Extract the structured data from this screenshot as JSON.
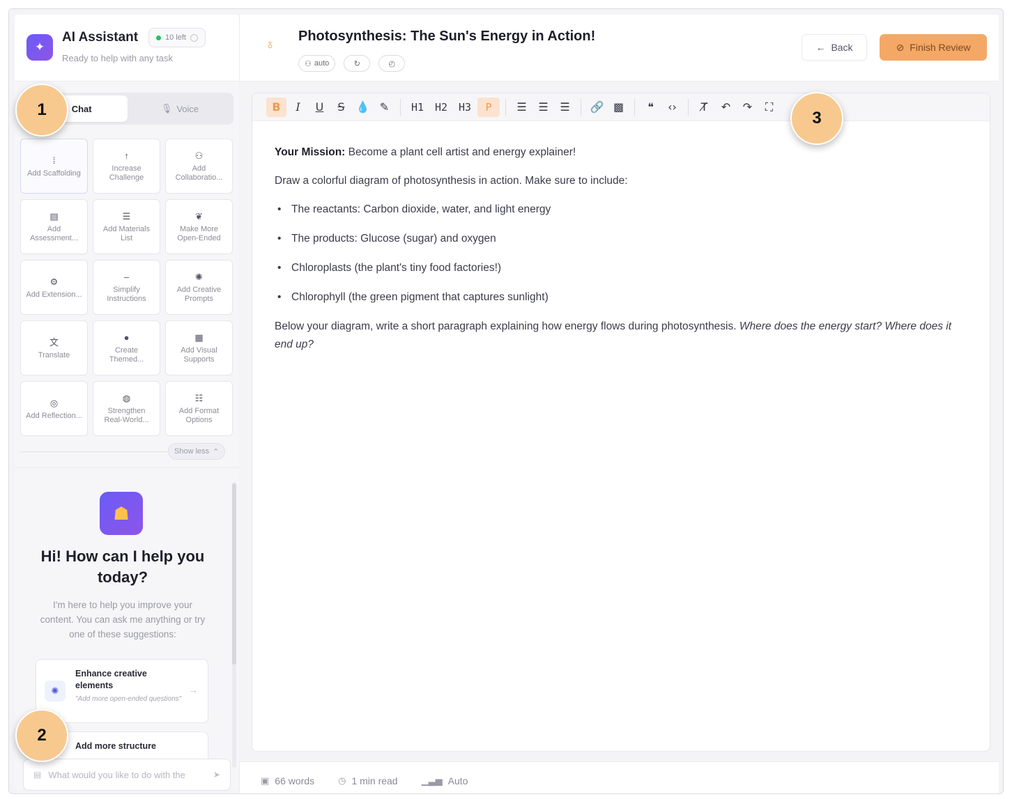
{
  "sidebar": {
    "title": "AI Assistant",
    "subtitle": "Ready to help with any task",
    "quota": "10 left",
    "tabs": [
      {
        "label": "Chat"
      },
      {
        "label": "Voice"
      }
    ],
    "quick_actions": [
      {
        "label": "Add Scaffolding",
        "icon": "ladder-icon"
      },
      {
        "label": "Increase Challenge",
        "icon": "arrow-up-icon"
      },
      {
        "label": "Add Collaboratio...",
        "icon": "group-icon"
      },
      {
        "label": "Add Assessment...",
        "icon": "clipboard-icon"
      },
      {
        "label": "Add Materials List",
        "icon": "list-icon"
      },
      {
        "label": "Make More Open-Ended",
        "icon": "brain-icon"
      },
      {
        "label": "Add Extension...",
        "icon": "extension-icon"
      },
      {
        "label": "Simplify Instructions",
        "icon": "minus-icon"
      },
      {
        "label": "Add Creative Prompts",
        "icon": "lightbulb-icon"
      },
      {
        "label": "Translate",
        "icon": "translate-icon"
      },
      {
        "label": "Create Themed...",
        "icon": "palette-icon"
      },
      {
        "label": "Add Visual Supports",
        "icon": "image-stack-icon"
      },
      {
        "label": "Add Reflection...",
        "icon": "reflection-icon"
      },
      {
        "label": "Strengthen Real-World...",
        "icon": "globe-icon"
      },
      {
        "label": "Add Format Options",
        "icon": "format-icon"
      }
    ],
    "show_less": "Show less",
    "greeting_title": "Hi! How can I help you today?",
    "greeting_sub": "I'm here to help you improve your content. You can ask me anything or try one of these suggestions:",
    "suggestions": [
      {
        "title": "Enhance creative elements",
        "desc": "\"Add more open-ended questions\""
      },
      {
        "title": "Add more structure",
        "desc": ""
      }
    ],
    "input_placeholder": "What would you like to do with the"
  },
  "doc": {
    "title": "Photosynthesis: The Sun's Energy in Action!",
    "chips": [
      "auto",
      "",
      ""
    ],
    "back_label": "Back",
    "finish_label": "Finish Review"
  },
  "toolbar": {
    "h1": "H1",
    "h2": "H2",
    "h3": "H3",
    "p": "P"
  },
  "content": {
    "mission_label": "Your Mission:",
    "mission_text": " Become a plant cell artist and energy explainer!",
    "intro": "Draw a colorful diagram of photosynthesis in action. Make sure to include:",
    "bullets": [
      "The reactants: Carbon dioxide, water, and light energy",
      "The products: Glucose (sugar) and oxygen",
      "Chloroplasts (the plant's tiny food factories!)",
      "Chlorophyll (the green pigment that captures sunlight)"
    ],
    "closing_plain": "Below your diagram, write a short paragraph explaining how energy flows during photosynthesis. ",
    "closing_italic": "Where does the energy start? Where does it end up?"
  },
  "status": {
    "words": "66 words",
    "read_time": "1 min read",
    "level": "Auto"
  },
  "callouts": [
    "1",
    "2",
    "3"
  ],
  "colors": {
    "accent_orange": "#f4a866",
    "callout": "#f8c98f",
    "brand_purple": "#6a5cf6"
  }
}
